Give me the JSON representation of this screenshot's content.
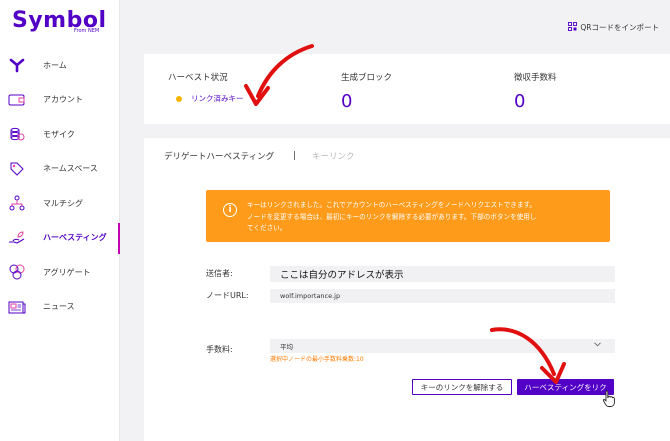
{
  "app": {
    "logo_text": "Symbol",
    "logo_subtext": "From NEM",
    "brand_color": "#5200c6",
    "active_indicator_color": "#c600ac"
  },
  "sidebar": {
    "items": [
      {
        "label": "ホーム",
        "icon": "symbol-y-icon"
      },
      {
        "label": "アカウント",
        "icon": "wallet-icon"
      },
      {
        "label": "モザイク",
        "icon": "coins-stack-icon"
      },
      {
        "label": "ネームスペース",
        "icon": "tag-icon"
      },
      {
        "label": "マルチシグ",
        "icon": "multisig-tree-icon"
      },
      {
        "label": "ハーベスティング",
        "icon": "harvest-hand-icon",
        "active": true
      },
      {
        "label": "アグリゲート",
        "icon": "aggregate-circles-icon"
      },
      {
        "label": "ニュース",
        "icon": "newspaper-icon"
      }
    ]
  },
  "topbar": {
    "qr_import_label": "QRコードをインポート"
  },
  "stats": {
    "harvest_status_title": "ハーベスト状況",
    "harvest_status_value": "リンク済みキー",
    "status_dot_color": "#f5b400",
    "blocks_title": "生成ブロック",
    "blocks_value": "0",
    "fees_title": "徴収手数料",
    "fees_value": "0"
  },
  "tabs": {
    "delegated": "デリゲートハーベスティング",
    "separator": "|",
    "key_link": "キーリンク"
  },
  "info_box": {
    "line1": "キーはリンクされました。これでアカウントのハーベスティングをノードへリクエストできます。",
    "line2": "ノードを変更する場合は、最初にキーのリンクを解除する必要があります。下部のボタンを使用し",
    "line3": "てください。",
    "color": "#ff9b1a"
  },
  "form": {
    "sender_label": "送信者:",
    "sender_value": "ここは自分のアドレスが表示",
    "node_label": "ノードURL:",
    "node_value": "wolf.importance.jp",
    "fee_label": "手数料:",
    "fee_value": "平均",
    "fee_hint": "選択中ノードの最小手数料乗数:10"
  },
  "buttons": {
    "unlink_label": "キーのリンクを解除する",
    "request_label": "ハーベスティングをリク"
  },
  "annotation_color": "#e01010"
}
